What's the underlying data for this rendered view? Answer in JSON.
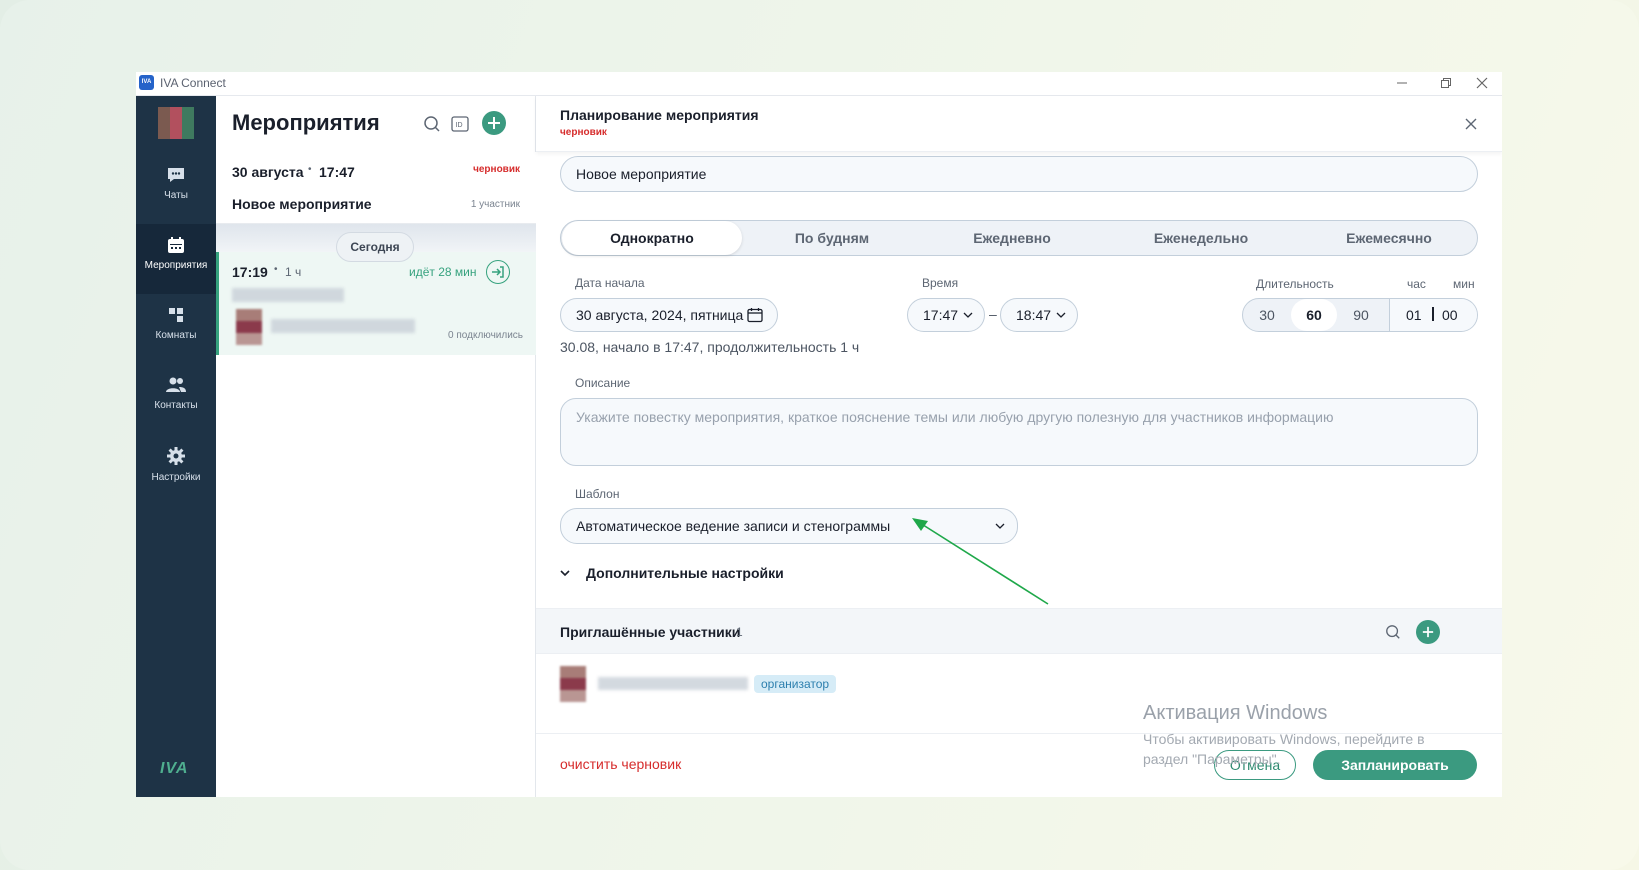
{
  "window": {
    "app_title": "IVA Connect",
    "logo_text": "IVA"
  },
  "sidebar": {
    "items": [
      {
        "label": "Чаты",
        "icon": "chat-icon"
      },
      {
        "label": "Мероприятия",
        "icon": "calendar-icon",
        "active": true
      },
      {
        "label": "Комнаты",
        "icon": "rooms-icon"
      },
      {
        "label": "Контакты",
        "icon": "contacts-icon"
      },
      {
        "label": "Настройки",
        "icon": "gear-icon"
      }
    ],
    "brand": "IVA"
  },
  "events": {
    "title": "Мероприятия",
    "draft_event": {
      "date": "30 августа",
      "dot": "•",
      "time": "17:47",
      "status": "черновик",
      "name": "Новое мероприятие",
      "participants": "1 участник"
    },
    "today_label": "Сегодня",
    "live_event": {
      "time": "17:19",
      "dot": "•",
      "duration": "1 ч",
      "status": "идёт 28 мин",
      "connected": "0 подключились"
    }
  },
  "plan": {
    "title": "Планирование мероприятия",
    "status": "черновик",
    "name_value": "Новое мероприятие",
    "recurrence": [
      "Однократно",
      "По будням",
      "Ежедневно",
      "Еженедельно",
      "Ежемесячно"
    ],
    "recurrence_active": 0,
    "start_date_label": "Дата начала",
    "start_date_value": "30 августа, 2024, пятница",
    "time_label": "Время",
    "time_start": "17:47",
    "time_dash": "–",
    "time_end": "18:47",
    "duration_label": "Длительность",
    "duration_hours_label": "час",
    "duration_minutes_label": "мин",
    "duration_options": [
      "30",
      "60",
      "90"
    ],
    "duration_active": 1,
    "duration_hours": "01",
    "duration_minutes": "00",
    "summary": "30.08, начало в 17:47, продолжительность 1 ч",
    "description_label": "Описание",
    "description_placeholder": "Укажите повестку мероприятия, краткое пояснение темы или любую другую полезную для участников информацию",
    "template_label": "Шаблон",
    "template_value": "Автоматическое ведение записи и стенограммы",
    "advanced_label": "Дополнительные настройки",
    "invited_label": "Приглашённые участники",
    "invited_count": "1",
    "organizer_badge": "организатор",
    "clear_draft": "очистить черновик",
    "cancel": "Отмена",
    "schedule": "Запланировать"
  },
  "watermark": {
    "title": "Активация Windows",
    "text": "Чтобы активировать Windows, перейдите в раздел \"Параметры\"."
  },
  "colors": {
    "accent": "#3b9a80",
    "sidebar": "#1e3346",
    "draft": "#d62c2c",
    "arrow": "#1fa84a"
  }
}
